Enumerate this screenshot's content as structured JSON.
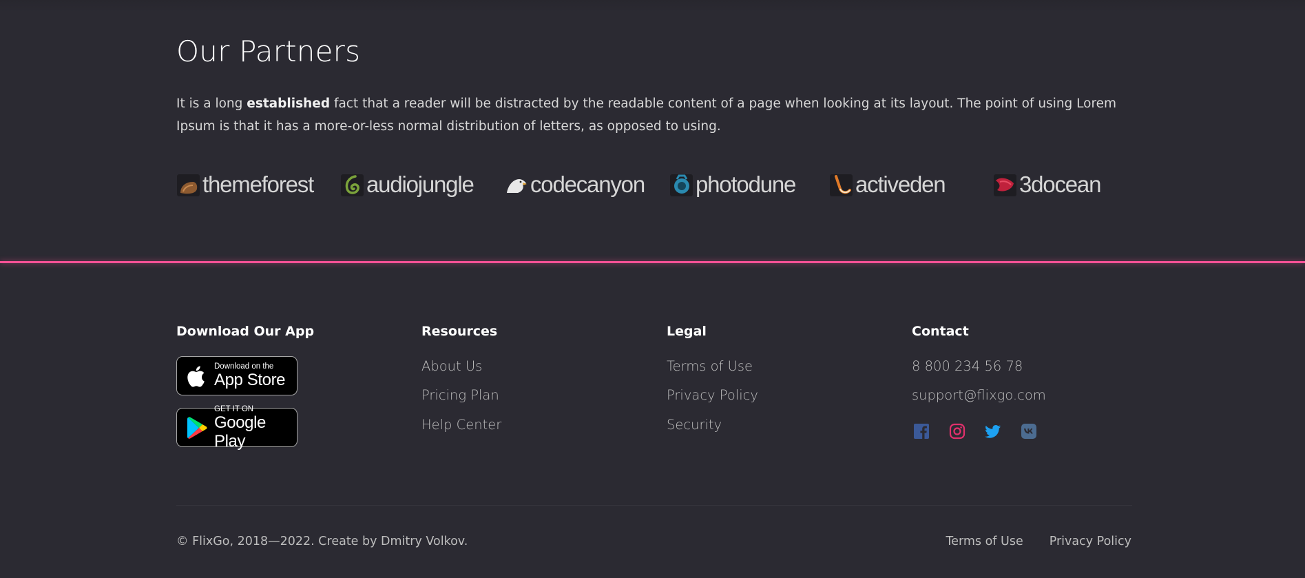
{
  "partners": {
    "title": "Our Partners",
    "text_before": "It is a long ",
    "text_bold": "established",
    "text_after": " fact that a reader will be distracted by the readable content of a page when looking at its layout. The point of using Lorem Ipsum is that it has a more-or-less normal distribution of letters, as opposed to using.",
    "logos": [
      {
        "name": "themeforest",
        "icon": "themeforest-icon",
        "color": "#8d5a30"
      },
      {
        "name": "audiojungle",
        "icon": "audiojungle-icon",
        "color": "#7ba33b"
      },
      {
        "name": "codecanyon",
        "icon": "codecanyon-icon",
        "color": "#e6e6e6"
      },
      {
        "name": "photodune",
        "icon": "photodune-icon",
        "color": "#2a8ab0"
      },
      {
        "name": "activeden",
        "icon": "activeden-icon",
        "color": "#e07a28"
      },
      {
        "name": "3docean",
        "icon": "3docean-icon",
        "color": "#c0213c"
      }
    ]
  },
  "accent_color": "#ff5296",
  "footer": {
    "app": {
      "title": "Download Our App",
      "appstore_small": "Download on the",
      "appstore_big": "App Store",
      "googleplay_small": "GET IT ON",
      "googleplay_big": "Google Play"
    },
    "resources": {
      "title": "Resources",
      "links": [
        "About Us",
        "Pricing Plan",
        "Help Center"
      ]
    },
    "legal": {
      "title": "Legal",
      "links": [
        "Terms of Use",
        "Privacy Policy",
        "Security"
      ]
    },
    "contact": {
      "title": "Contact",
      "phone": "8 800 234 56 78",
      "email": "support@flixgo.com",
      "socials": [
        {
          "icon": "facebook-icon",
          "color": "#3b5998"
        },
        {
          "icon": "instagram-icon",
          "color": "#e1306c"
        },
        {
          "icon": "twitter-icon",
          "color": "#1da1f2"
        },
        {
          "icon": "vk-icon",
          "color": "#4c6c91"
        }
      ]
    }
  },
  "bottom": {
    "copyright": "© FlixGo, 2018—2022. Create by Dmitry Volkov.",
    "links": [
      "Terms of Use",
      "Privacy Policy"
    ]
  }
}
